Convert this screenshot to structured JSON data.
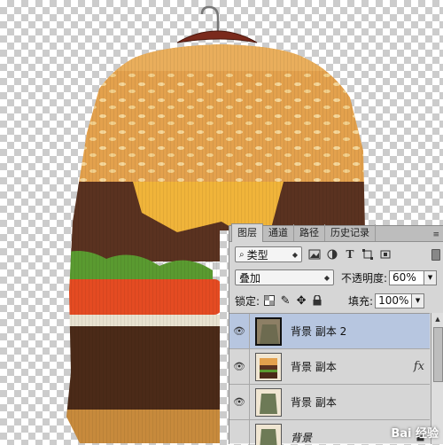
{
  "layers_panel": {
    "tabs": [
      {
        "label": "图层"
      },
      {
        "label": "通道"
      },
      {
        "label": "路径"
      },
      {
        "label": "历史记录"
      }
    ],
    "filter_type": "类型",
    "blend_mode": "叠加",
    "opacity_label": "不透明度:",
    "opacity_value": "60%",
    "lock_label": "锁定:",
    "fill_label": "填充:",
    "fill_value": "100%",
    "layers": [
      {
        "name": "背景 副本 2",
        "selected": true,
        "fx": false
      },
      {
        "name": "背景 副本",
        "selected": false,
        "fx": true,
        "fx_label": "fx"
      },
      {
        "name": "背景 副本",
        "selected": false,
        "fx": false
      },
      {
        "name": "背景",
        "selected": false,
        "fx": false,
        "locked": true
      }
    ]
  },
  "watermark": "Bai 经验",
  "colors": {
    "panel_bg": "#d6d6d6",
    "selected_row": "#b7c6e0",
    "bun": "#e3a14d",
    "cheese": "#f0b43a",
    "patty": "#5a3220",
    "lettuce": "#5a9a30",
    "tomato": "#e44b22"
  }
}
